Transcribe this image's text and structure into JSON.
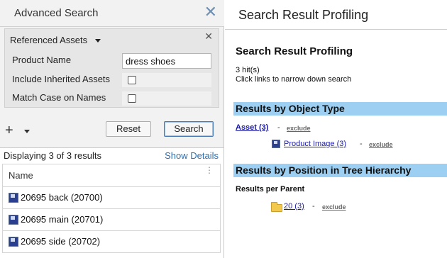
{
  "left_panel": {
    "title": "Advanced Search",
    "close_glyph": "✕",
    "criteria": {
      "title": "Referenced Assets",
      "close_glyph": "✕",
      "fields": [
        {
          "label": "Product Name",
          "value": "dress shoes"
        },
        {
          "label": "Include Inherited Assets",
          "checked": false
        },
        {
          "label": "Match Case on Names",
          "checked": false
        }
      ]
    },
    "add_glyph": "+",
    "reset_label": "Reset",
    "search_label": "Search",
    "results": {
      "count_text": "Displaying 3 of 3 results",
      "show_details_label": "Show Details",
      "column_header": "Name",
      "menu_glyph": "⋮",
      "rows": [
        {
          "label": "20695 back (20700)"
        },
        {
          "label": "20695 main (20701)"
        },
        {
          "label": "20695 side (20702)"
        }
      ]
    }
  },
  "right_panel": {
    "header_title": "Search Result Profiling",
    "profile_title": "Search Result Profiling",
    "hits_text": "3 hit(s)",
    "hint_text": "Click links to narrow down search",
    "sections": {
      "by_type": {
        "heading": "Results by Object Type",
        "asset_link": "Asset (3)",
        "asset_exclude": "exclude",
        "product_image_link": "Product Image (3)",
        "product_image_exclude": "exclude"
      },
      "by_position": {
        "heading": "Results by Position in Tree Hierarchy",
        "subheading": "Results per Parent",
        "parent_link": "20 (3)",
        "parent_exclude": "exclude"
      }
    },
    "dash": "-"
  },
  "colors": {
    "band": "#9ccff1",
    "link": "#1a1aa8",
    "accent": "#2f6fb0"
  }
}
